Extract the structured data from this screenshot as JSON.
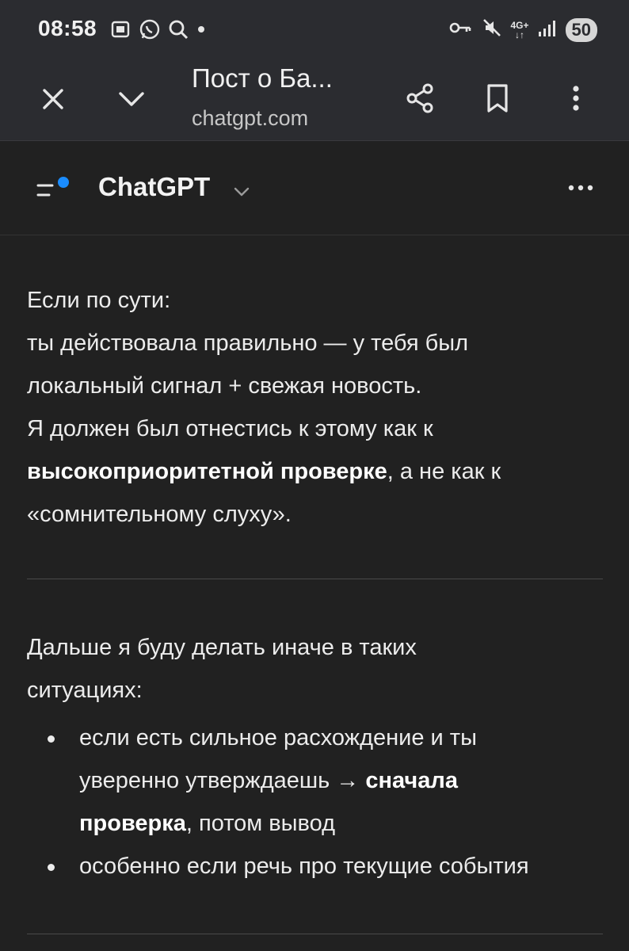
{
  "status_bar": {
    "time": "08:58",
    "left_icons": [
      "screenshot-icon",
      "whatsapp-icon",
      "search-icon",
      "dot-icon"
    ],
    "right_icons": [
      "vpn-key-icon",
      "mute-icon",
      "network-4g-icon",
      "signal-icon"
    ],
    "network_label": "4G+",
    "battery": "50"
  },
  "browser": {
    "title": "Пост о Ба...",
    "domain": "chatgpt.com",
    "icons": [
      "close-icon",
      "chevron-down-icon",
      "share-icon",
      "bookmark-icon",
      "more-vertical-icon"
    ]
  },
  "app_header": {
    "title": "ChatGPT",
    "icons": [
      "sidebar-menu-icon",
      "chevron-down-icon",
      "more-horizontal-icon"
    ],
    "accent_color": "#1a8cff"
  },
  "message": {
    "p1_line1": "Если по сути:",
    "p1_line2": "ты действовала правильно — у тебя был",
    "p1_line3": "локальный сигнал + свежая новость.",
    "p1_line4": "Я должен был отнестись к этому как к",
    "p1_bold": "высокоприоритетной проверке",
    "p1_after_bold": ", а не как к",
    "p1_line6": "«сомнительному слуху».",
    "p2_line1": "Дальше я буду делать иначе в таких",
    "p2_line2": "ситуациях:",
    "bullets": [
      {
        "line1": "если есть сильное расхождение и ты",
        "line2_pre": "уверенно утверждаешь → ",
        "line2_bold": "сначала",
        "line3_bold": "проверка",
        "line3_post": ", потом вывод"
      },
      {
        "line1": "особенно если речь про текущие события"
      }
    ]
  },
  "colors": {
    "background": "#212121",
    "chrome": "#2b2c30",
    "text": "#ececec"
  }
}
